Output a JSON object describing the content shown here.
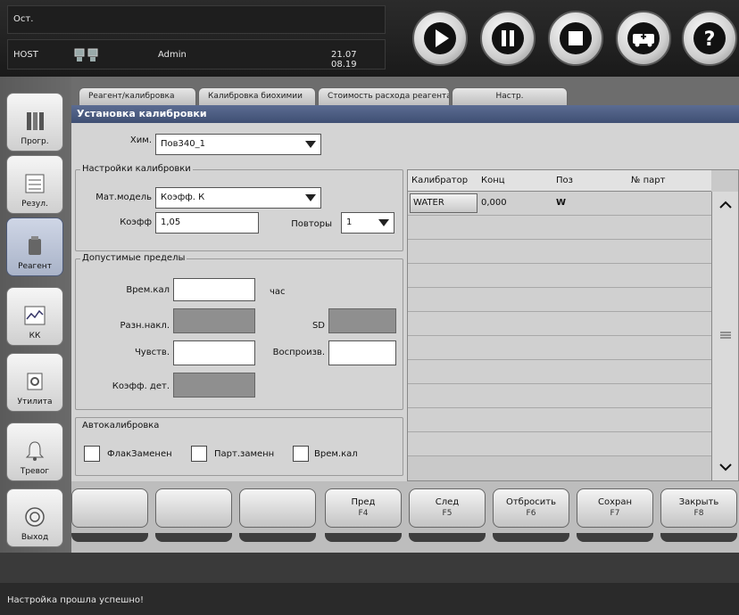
{
  "top": {
    "status": "Ост.",
    "host": "HOST",
    "user": "Admin",
    "datetime": "21.07 08.19"
  },
  "controls": [
    {
      "icon": "play-icon"
    },
    {
      "icon": "pause-icon"
    },
    {
      "icon": "stop-icon"
    },
    {
      "icon": "emergency-vehicle-icon"
    },
    {
      "icon": "help-icon",
      "label": "?"
    }
  ],
  "nav": [
    {
      "label": "Прогр.",
      "icon": "program-icon"
    },
    {
      "label": "Резул.",
      "icon": "results-icon"
    },
    {
      "label": "Реагент",
      "icon": "reagent-icon",
      "active": true
    },
    {
      "label": "КК",
      "icon": "qc-chart-icon"
    },
    {
      "label": "Утилита",
      "icon": "utility-icon"
    },
    {
      "label": "Тревог",
      "icon": "alarm-bell-icon"
    },
    {
      "label": "Выход",
      "icon": "exit-icon"
    }
  ],
  "tabs": [
    "Реагент/калибровка",
    "Калибровка биохимии",
    "Стоимость расхода реагента",
    "Настр."
  ],
  "dialog": {
    "title": "Установка калибровки",
    "chem_label": "Хим.",
    "chem_value": "Пов340_1",
    "calib_settings_title": "Настройки калибровки",
    "math_model_label": "Мат.модель",
    "math_model_value": "Коэфф. К",
    "coef_label": "Коэфф",
    "coef_value": "1,05",
    "repeats_label": "Повторы",
    "repeats_value": "1",
    "limits_title": "Допустимые пределы",
    "cal_time_label": "Врем.кал",
    "cal_time_value": "",
    "hours_unit": "час",
    "slope_diff_label": "Разн.накл.",
    "sd_label": "SD",
    "sensitivity_label": "Чувств.",
    "sensitivity_value": "",
    "reproducibility_label": "Воспроизв.",
    "reproducibility_value": "",
    "det_coef_label": "Коэфф. дет.",
    "autocal_title": "Автокалибровка",
    "autocal_options": [
      "ФлакЗаменен",
      "Парт.заменн",
      "Врем.кал"
    ]
  },
  "table": {
    "headers": [
      "Калибратор",
      "Конц",
      "Поз",
      "№ парт"
    ],
    "rows": [
      {
        "calibrator": "WATER",
        "conc": "0,000",
        "pos": "W",
        "lot": ""
      }
    ]
  },
  "buttons": [
    {
      "label": "",
      "key": ""
    },
    {
      "label": "",
      "key": ""
    },
    {
      "label": "",
      "key": ""
    },
    {
      "label": "Пред",
      "key": "F4"
    },
    {
      "label": "След",
      "key": "F5"
    },
    {
      "label": "Отбросить",
      "key": "F6"
    },
    {
      "label": "Сохран",
      "key": "F7"
    },
    {
      "label": "Закрыть",
      "key": "F8"
    }
  ],
  "status_message": "Настройка прошла успешно!"
}
